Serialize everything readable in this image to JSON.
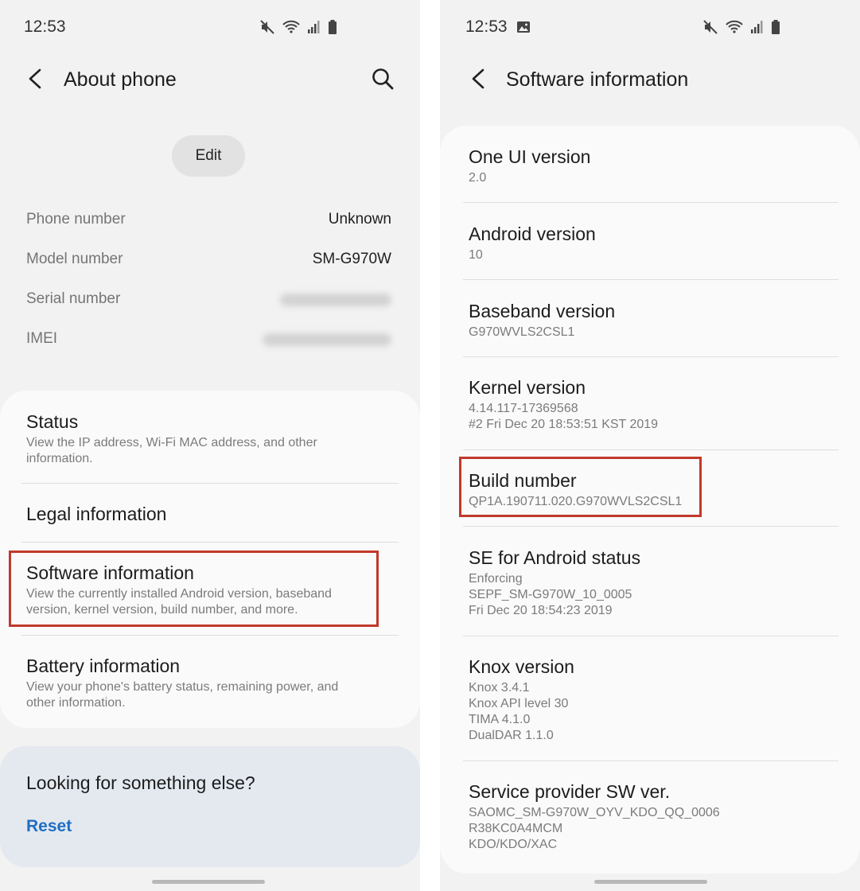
{
  "left": {
    "status_time": "12:53",
    "header": {
      "title": "About phone"
    },
    "edit_label": "Edit",
    "info": {
      "phone_label": "Phone number",
      "phone_value": "Unknown",
      "model_label": "Model number",
      "model_value": "SM-G970W",
      "serial_label": "Serial number",
      "imei_label": "IMEI"
    },
    "items": [
      {
        "title": "Status",
        "sub1": "View the IP address, Wi-Fi MAC address, and other",
        "sub2": "information."
      },
      {
        "title": "Legal information"
      },
      {
        "title": "Software information",
        "sub1": "View the currently installed Android version, baseband",
        "sub2": "version, kernel version, build number, and more."
      },
      {
        "title": "Battery information",
        "sub1": "View your phone's battery status, remaining power, and",
        "sub2": "other information."
      }
    ],
    "looking": {
      "title": "Looking for something else?",
      "reset": "Reset"
    }
  },
  "right": {
    "status_time": "12:53",
    "header": {
      "title": "Software information"
    },
    "items": [
      {
        "title": "One UI version",
        "lines": [
          "2.0"
        ]
      },
      {
        "title": "Android version",
        "lines": [
          "10"
        ]
      },
      {
        "title": "Baseband version",
        "lines": [
          "G970WVLS2CSL1"
        ]
      },
      {
        "title": "Kernel version",
        "lines": [
          "4.14.117-17369568",
          "#2 Fri Dec 20 18:53:51 KST 2019"
        ]
      },
      {
        "title": "Build number",
        "lines": [
          "QP1A.190711.020.G970WVLS2CSL1"
        ]
      },
      {
        "title": "SE for Android status",
        "lines": [
          "Enforcing",
          "SEPF_SM-G970W_10_0005",
          "Fri Dec 20 18:54:23 2019"
        ]
      },
      {
        "title": "Knox version",
        "lines": [
          "Knox 3.4.1",
          "Knox API level 30",
          "TIMA 4.1.0",
          "DualDAR 1.1.0"
        ]
      },
      {
        "title": "Service provider SW ver.",
        "lines": [
          "SAOMC_SM-G970W_OYV_KDO_QQ_0006",
          "R38KC0A4MCM",
          "KDO/KDO/XAC"
        ]
      }
    ]
  },
  "colors": {
    "highlight": "#c0392b",
    "link": "#1f6fc2",
    "card": "#fafafa",
    "bg": "#f2f2f2"
  }
}
